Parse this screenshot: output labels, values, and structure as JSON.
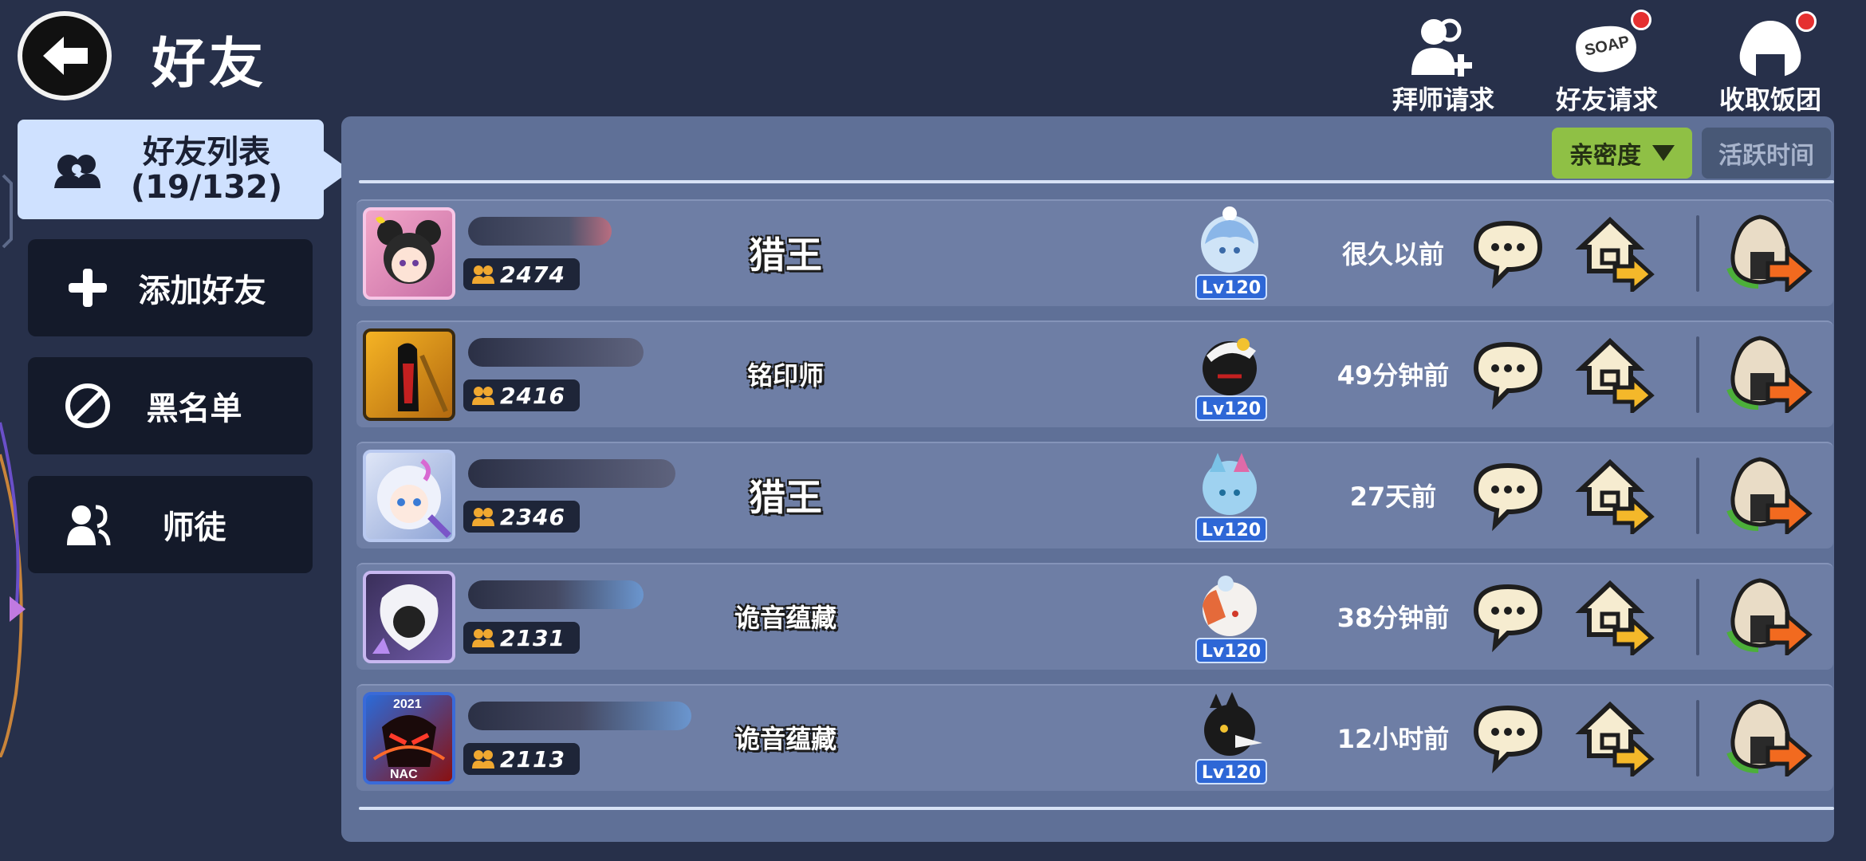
{
  "header": {
    "title": "好友",
    "actions": [
      {
        "label": "拜师请求",
        "icon": "add-mentor-icon",
        "notify": false
      },
      {
        "label": "好友请求",
        "icon": "soap-request-icon",
        "notify": true
      },
      {
        "label": "收取饭团",
        "icon": "rice-ball-icon",
        "notify": true
      }
    ]
  },
  "sidebar": {
    "tabs": [
      {
        "label": "好友列表",
        "sub": "(19/132)",
        "icon": "friends-list-icon",
        "active": true
      },
      {
        "label": "添加好友",
        "icon": "plus-icon",
        "active": false
      },
      {
        "label": "黑名单",
        "icon": "ban-icon",
        "active": false
      },
      {
        "label": "师徒",
        "icon": "mentor-icon",
        "active": false
      }
    ]
  },
  "sort": {
    "primary": "亲密度",
    "secondary": "活跃时间"
  },
  "friends": [
    {
      "power": "2474",
      "title": "猎王",
      "level": "Lv120",
      "time": "很久以前"
    },
    {
      "power": "2416",
      "title": "铭印师",
      "level": "Lv120",
      "time": "49分钟前"
    },
    {
      "power": "2346",
      "title": "猎王",
      "level": "Lv120",
      "time": "27天前"
    },
    {
      "power": "2131",
      "title": "诡音蕴藏",
      "level": "Lv120",
      "time": "38分钟前"
    },
    {
      "power": "2113",
      "title": "诡音蕴藏",
      "level": "Lv120",
      "time": "12小时前"
    }
  ],
  "avatar_labels": {
    "row5_year": "2021",
    "row5_tag": "NAC"
  },
  "colors": {
    "accent_green": "#8fc045",
    "level_blue": "#2e67d6",
    "active_tab": "#cfe1ff",
    "power_gold": "#f0a830"
  }
}
